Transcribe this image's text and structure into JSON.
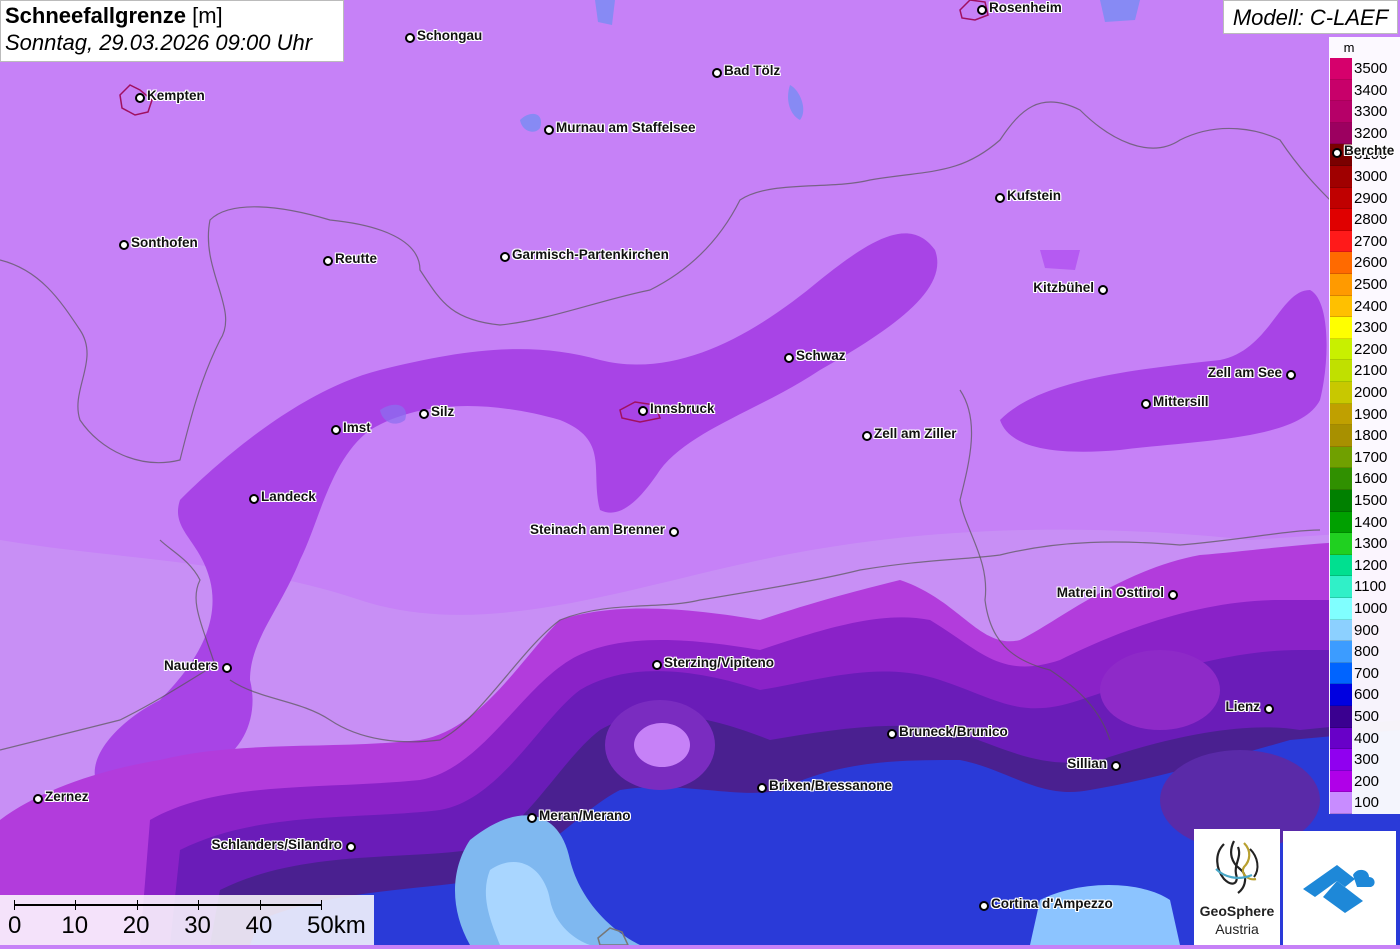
{
  "header": {
    "title": "Schneefallgrenze",
    "unit": "[m]",
    "datetime": "Sonntag, 29.03.2026 09:00 Uhr"
  },
  "model": "Modell: C-LAEF",
  "legend": {
    "unit": "m",
    "items": [
      {
        "label": "3500",
        "color": "#d6006c"
      },
      {
        "label": "3400",
        "color": "#c8006a"
      },
      {
        "label": "3300",
        "color": "#b60068"
      },
      {
        "label": "3200",
        "color": "#9c0060"
      },
      {
        "label": "3100",
        "color": "#7a0000"
      },
      {
        "label": "3000",
        "color": "#a00000"
      },
      {
        "label": "2900",
        "color": "#c00000"
      },
      {
        "label": "2800",
        "color": "#e00000"
      },
      {
        "label": "2700",
        "color": "#ff1a1a"
      },
      {
        "label": "2600",
        "color": "#ff6a00"
      },
      {
        "label": "2500",
        "color": "#ff9a00"
      },
      {
        "label": "2400",
        "color": "#ffc000"
      },
      {
        "label": "2300",
        "color": "#ffff00"
      },
      {
        "label": "2200",
        "color": "#c8f000"
      },
      {
        "label": "2100",
        "color": "#c0e000"
      },
      {
        "label": "2000",
        "color": "#c8c800"
      },
      {
        "label": "1900",
        "color": "#c0a000"
      },
      {
        "label": "1800",
        "color": "#a89000"
      },
      {
        "label": "1700",
        "color": "#70a000"
      },
      {
        "label": "1600",
        "color": "#309000"
      },
      {
        "label": "1500",
        "color": "#008000"
      },
      {
        "label": "1400",
        "color": "#00a000"
      },
      {
        "label": "1300",
        "color": "#20d020"
      },
      {
        "label": "1200",
        "color": "#00e090"
      },
      {
        "label": "1100",
        "color": "#30f0c8"
      },
      {
        "label": "1000",
        "color": "#80ffff"
      },
      {
        "label": "900",
        "color": "#8cd0ff"
      },
      {
        "label": "800",
        "color": "#3c9cff"
      },
      {
        "label": "700",
        "color": "#0064ff"
      },
      {
        "label": "600",
        "color": "#0000e0"
      },
      {
        "label": "500",
        "color": "#3a0090"
      },
      {
        "label": "400",
        "color": "#6800c8"
      },
      {
        "label": "300",
        "color": "#9000f0"
      },
      {
        "label": "200",
        "color": "#b000e8"
      },
      {
        "label": "100",
        "color": "#c88cff"
      }
    ]
  },
  "cities": [
    {
      "name": "Rosenheim",
      "side": "right"
    },
    {
      "name": "Schongau",
      "side": "right"
    },
    {
      "name": "Kempten",
      "side": "right"
    },
    {
      "name": "Bad Tölz",
      "side": "right"
    },
    {
      "name": "Murnau am Staffelsee",
      "side": "right"
    },
    {
      "name": "Berchte",
      "side": "right"
    },
    {
      "name": "Kufstein",
      "side": "right"
    },
    {
      "name": "Sonthofen",
      "side": "right"
    },
    {
      "name": "Reutte",
      "side": "right"
    },
    {
      "name": "Garmisch-Partenkirchen",
      "side": "right"
    },
    {
      "name": "Kitzbühel",
      "side": "left"
    },
    {
      "name": "Schwaz",
      "side": "right"
    },
    {
      "name": "Zell am See",
      "side": "left"
    },
    {
      "name": "Mittersill",
      "side": "right"
    },
    {
      "name": "Imst",
      "side": "right"
    },
    {
      "name": "Silz",
      "side": "right"
    },
    {
      "name": "Innsbruck",
      "side": "right"
    },
    {
      "name": "Zell am Ziller",
      "side": "right"
    },
    {
      "name": "Landeck",
      "side": "right"
    },
    {
      "name": "Steinach am Brenner",
      "side": "left"
    },
    {
      "name": "Matrei in Osttirol",
      "side": "left"
    },
    {
      "name": "Nauders",
      "side": "left"
    },
    {
      "name": "Sterzing/Vipiteno",
      "side": "right"
    },
    {
      "name": "Lienz",
      "side": "left"
    },
    {
      "name": "Bruneck/Brunico",
      "side": "right"
    },
    {
      "name": "Sillian",
      "side": "left"
    },
    {
      "name": "Brixen/Bressanone",
      "side": "right"
    },
    {
      "name": "Zernez",
      "side": "right"
    },
    {
      "name": "Meran/Merano",
      "side": "right"
    },
    {
      "name": "Schlanders/Silandro",
      "side": "left"
    },
    {
      "name": "Cortina d'Ampezzo",
      "side": "right"
    }
  ],
  "scale": {
    "labels": [
      "0",
      "10",
      "20",
      "30",
      "40",
      "50km"
    ]
  },
  "logos": {
    "geosphere_line1": "GeoSphere",
    "geosphere_line2": "Austria"
  }
}
